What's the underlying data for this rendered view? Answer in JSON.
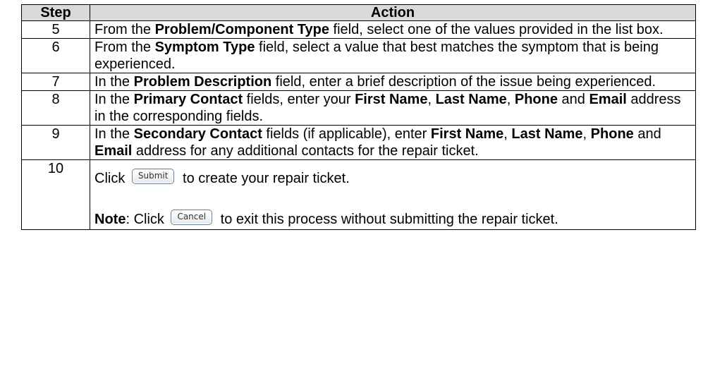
{
  "headers": {
    "step": "Step",
    "action": "Action"
  },
  "rows": [
    {
      "step": "5",
      "p1": "From the ",
      "b1": "Problem/Component Type",
      "p2": " field, select one of the values provided in the list box."
    },
    {
      "step": "6",
      "p1": "From the ",
      "b1": "Symptom Type",
      "p2": " field, select a value that best matches the symptom that is being experienced."
    },
    {
      "step": "7",
      "p1": "In the ",
      "b1": "Problem Description",
      "p2": " field, enter a brief description of the issue being experienced."
    },
    {
      "step": "8",
      "p1": "In the ",
      "b1": "Primary Contact",
      "p2": " fields, enter your ",
      "b2": "First Name",
      "p3": ", ",
      "b3": "Last Name",
      "p4": ", ",
      "b4": "Phone",
      "p5": " and ",
      "b5": "Email",
      "p6": " address in the corresponding fields."
    },
    {
      "step": "9",
      "p1": "In the ",
      "b1": "Secondary Contact",
      "p2": " fields (if applicable), enter ",
      "b2": "First Name",
      "p3": ", ",
      "b3": "Last Name",
      "p4": ", ",
      "b4": "Phone",
      "p5": " and ",
      "b5": "Email",
      "p6": " address for any additional contacts for the repair ticket."
    },
    {
      "step": "10",
      "click1": "Click ",
      "submit_label": "Submit",
      "after_submit": " to create your repair ticket.",
      "note_label": "Note",
      "note_colon": ":  Click ",
      "cancel_label": "Cancel",
      "after_cancel": " to exit this process without submitting the repair ticket."
    }
  ]
}
